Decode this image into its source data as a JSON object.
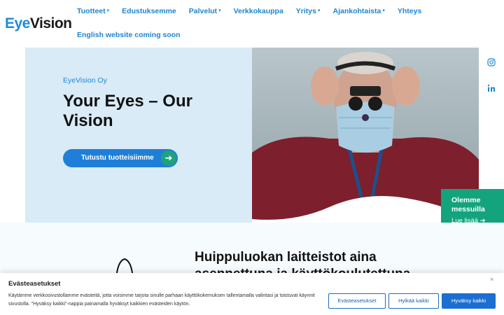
{
  "logo": {
    "part1": "Eye",
    "part2": "Vision"
  },
  "nav": {
    "items": [
      {
        "label": "Tuotteet",
        "dropdown": true
      },
      {
        "label": "Edustuksemme",
        "dropdown": false
      },
      {
        "label": "Palvelut",
        "dropdown": true
      },
      {
        "label": "Verkkokauppa",
        "dropdown": false
      },
      {
        "label": "Yritys",
        "dropdown": true
      },
      {
        "label": "Ajankohtaista",
        "dropdown": true
      },
      {
        "label": "Yhteys",
        "dropdown": false
      }
    ],
    "english": "English website coming soon",
    "caret": "▾"
  },
  "hero": {
    "subtitle": "EyeVision Oy",
    "title": "Your Eyes – Our Vision",
    "button_label": "Tutustu tuotteisiimme",
    "button_arrow": "➔"
  },
  "social": {
    "icons": [
      "instagram-icon",
      "linkedin-icon"
    ]
  },
  "promo": {
    "title": "Olemme messuilla",
    "link": "Lue lisää",
    "arrow": "➔"
  },
  "section": {
    "title": "Huippuluokan laitteistot aina asennettuna ja käyttökoulutettuna"
  },
  "cookie": {
    "title": "Evästeasetukset",
    "text": "Käytämme verkkosivustollamme evästeitä, jotta voisimme tarjota sinulle parhaan käyttökokemuksen tallentamalla valintasi ja toistuvat käynnit sivustolla. \"Hyväksy kaikki\"-nappia painamalla hyväksyt kaikkien evästeiden käytön.",
    "close": "×",
    "buttons": {
      "settings": "Evästeasetukset",
      "reject": "Hylkää kaikki",
      "accept": "Hyväksy kaikki"
    }
  },
  "colors": {
    "brand_blue": "#1e86d0",
    "accent_green": "#13a37d",
    "hero_bg": "#d8ebf6"
  }
}
